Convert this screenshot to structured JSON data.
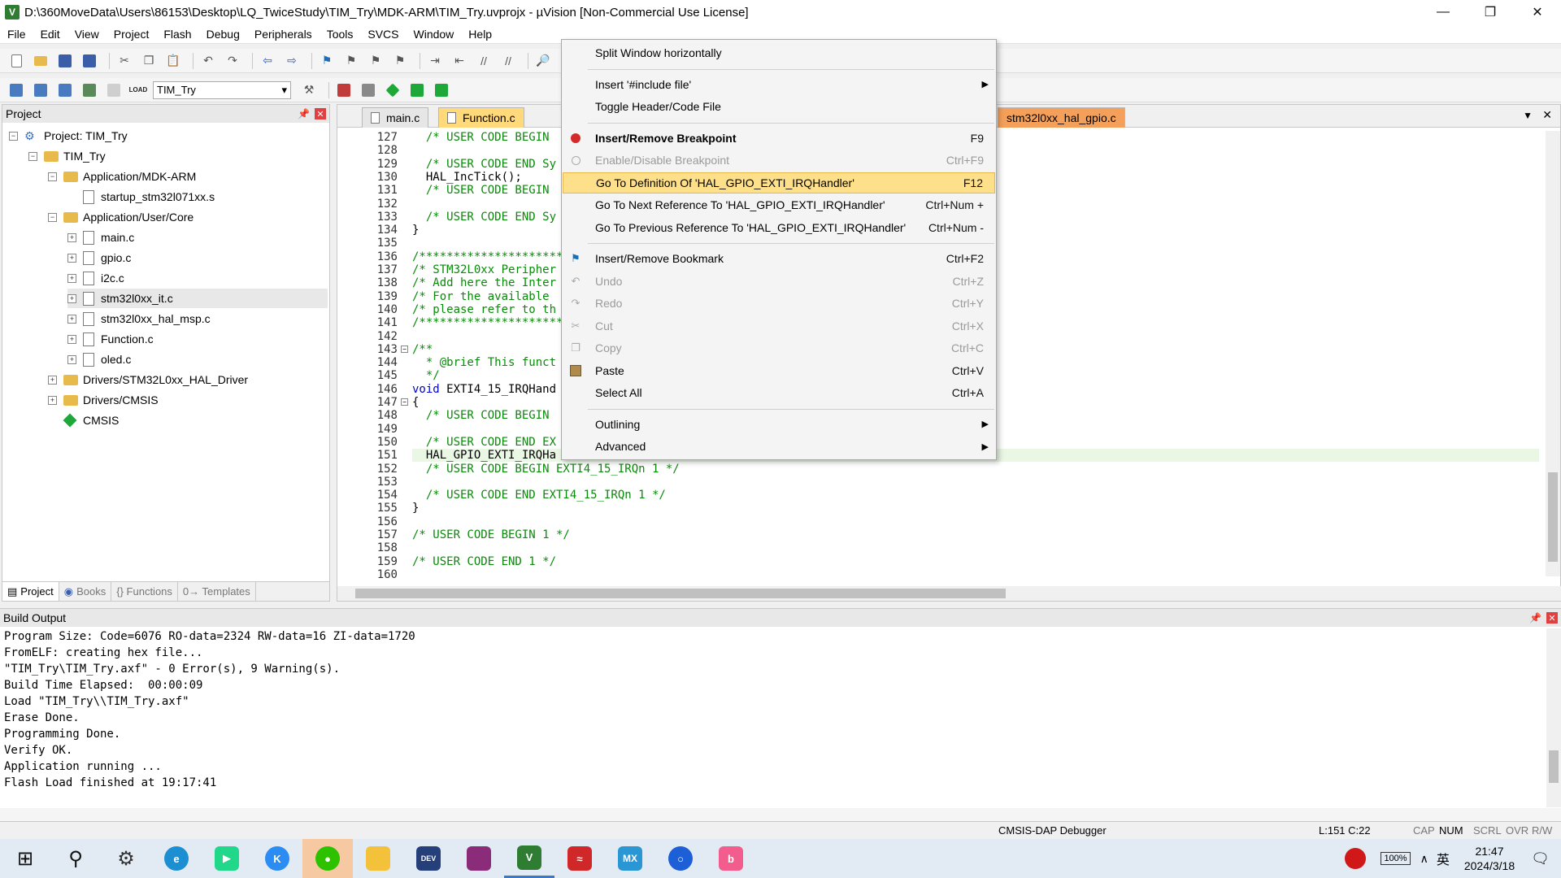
{
  "window": {
    "title": "D:\\360MoveData\\Users\\86153\\Desktop\\LQ_TwiceStudy\\TIM_Try\\MDK-ARM\\TIM_Try.uvprojx - µVision  [Non-Commercial Use License]",
    "app_icon_letter": "V"
  },
  "menubar": [
    "File",
    "Edit",
    "View",
    "Project",
    "Flash",
    "Debug",
    "Peripherals",
    "Tools",
    "SVCS",
    "Window",
    "Help"
  ],
  "toolbar2": {
    "target": "TIM_Try",
    "load_label": "LOAD"
  },
  "project_panel": {
    "title": "Project",
    "tree": [
      {
        "label": "Project: TIM_Try",
        "level": 0,
        "kind": "project",
        "exp": "−"
      },
      {
        "label": "TIM_Try",
        "level": 1,
        "kind": "target",
        "exp": "−"
      },
      {
        "label": "Application/MDK-ARM",
        "level": 2,
        "kind": "folder",
        "exp": "−"
      },
      {
        "label": "startup_stm32l071xx.s",
        "level": 3,
        "kind": "file",
        "exp": ""
      },
      {
        "label": "Application/User/Core",
        "level": 2,
        "kind": "folder",
        "exp": "−"
      },
      {
        "label": "main.c",
        "level": 3,
        "kind": "file",
        "exp": "+"
      },
      {
        "label": "gpio.c",
        "level": 3,
        "kind": "file",
        "exp": "+"
      },
      {
        "label": "i2c.c",
        "level": 3,
        "kind": "file",
        "exp": "+"
      },
      {
        "label": "stm32l0xx_it.c",
        "level": 3,
        "kind": "file",
        "exp": "+",
        "selected": true
      },
      {
        "label": "stm32l0xx_hal_msp.c",
        "level": 3,
        "kind": "file",
        "exp": "+"
      },
      {
        "label": "Function.c",
        "level": 3,
        "kind": "file",
        "exp": "+"
      },
      {
        "label": "oled.c",
        "level": 3,
        "kind": "file",
        "exp": "+"
      },
      {
        "label": "Drivers/STM32L0xx_HAL_Driver",
        "level": 2,
        "kind": "folder",
        "exp": "+"
      },
      {
        "label": "Drivers/CMSIS",
        "level": 2,
        "kind": "folder",
        "exp": "+"
      },
      {
        "label": "CMSIS",
        "level": 2,
        "kind": "cmsis",
        "exp": ""
      }
    ],
    "bottom_tabs": [
      "Project",
      "Books",
      "{} Functions",
      "0→ Templates"
    ]
  },
  "editor": {
    "tabs": [
      "main.c",
      "Function.c",
      "stm32l0xx_hal_gpio.c"
    ],
    "lines": [
      {
        "n": "127",
        "t": "  /* USER CODE BEGIN",
        "c": "cm"
      },
      {
        "n": "128",
        "t": "",
        "c": ""
      },
      {
        "n": "129",
        "t": "  /* USER CODE END Sy",
        "c": "cm"
      },
      {
        "n": "130",
        "t": "  HAL_IncTick();",
        "c": ""
      },
      {
        "n": "131",
        "t": "  /* USER CODE BEGIN",
        "c": "cm"
      },
      {
        "n": "132",
        "t": "",
        "c": ""
      },
      {
        "n": "133",
        "t": "  /* USER CODE END Sy",
        "c": "cm"
      },
      {
        "n": "134",
        "t": "}",
        "c": ""
      },
      {
        "n": "135",
        "t": "",
        "c": ""
      },
      {
        "n": "136",
        "t": "/*********************",
        "c": "cm"
      },
      {
        "n": "137",
        "t": "/* STM32L0xx Peripher",
        "c": "cm"
      },
      {
        "n": "138",
        "t": "/* Add here the Inter",
        "c": "cm"
      },
      {
        "n": "139",
        "t": "/* For the available",
        "c": "cm"
      },
      {
        "n": "140",
        "t": "/* please refer to th",
        "c": "cm"
      },
      {
        "n": "141",
        "t": "/*********************",
        "c": "cm"
      },
      {
        "n": "142",
        "t": "",
        "c": ""
      },
      {
        "n": "143",
        "t": "/**",
        "c": "cm"
      },
      {
        "n": "144",
        "t": "  * @brief This funct",
        "c": "cm"
      },
      {
        "n": "145",
        "t": "  */",
        "c": "cm"
      },
      {
        "n": "146",
        "t": "void EXTI4_15_IRQHand",
        "c": "kwline"
      },
      {
        "n": "147",
        "t": "{",
        "c": ""
      },
      {
        "n": "148",
        "t": "  /* USER CODE BEGIN",
        "c": "cm"
      },
      {
        "n": "149",
        "t": "",
        "c": ""
      },
      {
        "n": "150",
        "t": "  /* USER CODE END EX",
        "c": "cm"
      },
      {
        "n": "151",
        "t": "  HAL_GPIO_EXTI_IRQHa",
        "c": "hl"
      },
      {
        "n": "152",
        "t": "  /* USER CODE BEGIN EXTI4_15_IRQn 1 */",
        "c": "cm"
      },
      {
        "n": "153",
        "t": "",
        "c": ""
      },
      {
        "n": "154",
        "t": "  /* USER CODE END EXTI4_15_IRQn 1 */",
        "c": "cm"
      },
      {
        "n": "155",
        "t": "}",
        "c": ""
      },
      {
        "n": "156",
        "t": "",
        "c": ""
      },
      {
        "n": "157",
        "t": "/* USER CODE BEGIN 1 */",
        "c": "cm"
      },
      {
        "n": "158",
        "t": "",
        "c": ""
      },
      {
        "n": "159",
        "t": "/* USER CODE END 1 */",
        "c": "cm"
      },
      {
        "n": "160",
        "t": "",
        "c": ""
      }
    ]
  },
  "context_menu": {
    "items": [
      {
        "label": "Split Window horizontally",
        "shortcut": "",
        "disabled": false,
        "icon": ""
      },
      {
        "sep": true
      },
      {
        "label": "Insert '#include file'",
        "shortcut": "",
        "submenu": true
      },
      {
        "label": "Toggle Header/Code File",
        "shortcut": ""
      },
      {
        "sep": true
      },
      {
        "label": "Insert/Remove Breakpoint",
        "shortcut": "F9",
        "bold": true,
        "icon": "breakpoint-icon"
      },
      {
        "label": "Enable/Disable Breakpoint",
        "shortcut": "Ctrl+F9",
        "disabled": true,
        "icon": "breakpoint-disabled-icon"
      },
      {
        "label": "Go To Definition Of 'HAL_GPIO_EXTI_IRQHandler'",
        "shortcut": "F12",
        "selected": true
      },
      {
        "label": "Go To Next Reference To 'HAL_GPIO_EXTI_IRQHandler'",
        "shortcut": "Ctrl+Num +"
      },
      {
        "label": "Go To Previous Reference To 'HAL_GPIO_EXTI_IRQHandler'",
        "shortcut": "Ctrl+Num -"
      },
      {
        "sep": true
      },
      {
        "label": "Insert/Remove Bookmark",
        "shortcut": "Ctrl+F2",
        "icon": "bookmark-icon"
      },
      {
        "label": "Undo",
        "shortcut": "Ctrl+Z",
        "disabled": true,
        "icon": "undo-icon"
      },
      {
        "label": "Redo",
        "shortcut": "Ctrl+Y",
        "disabled": true,
        "icon": "redo-icon"
      },
      {
        "label": "Cut",
        "shortcut": "Ctrl+X",
        "disabled": true,
        "icon": "cut-icon"
      },
      {
        "label": "Copy",
        "shortcut": "Ctrl+C",
        "disabled": true,
        "icon": "copy-icon"
      },
      {
        "label": "Paste",
        "shortcut": "Ctrl+V",
        "icon": "paste-icon"
      },
      {
        "label": "Select All",
        "shortcut": "Ctrl+A"
      },
      {
        "sep": true
      },
      {
        "label": "Outlining",
        "shortcut": "",
        "submenu": true
      },
      {
        "label": "Advanced",
        "shortcut": "",
        "submenu": true
      }
    ]
  },
  "build_output": {
    "title": "Build Output",
    "lines": [
      "Program Size: Code=6076 RO-data=2324 RW-data=16 ZI-data=1720",
      "FromELF: creating hex file...",
      "\"TIM_Try\\TIM_Try.axf\" - 0 Error(s), 9 Warning(s).",
      "Build Time Elapsed:  00:00:09",
      "Load \"TIM_Try\\\\TIM_Try.axf\"",
      "Erase Done.",
      "Programming Done.",
      "Verify OK.",
      "Application running ...",
      "Flash Load finished at 19:17:41"
    ]
  },
  "statusbar": {
    "debugger": "CMSIS-DAP Debugger",
    "position": "L:151 C:22",
    "cap": "CAP",
    "num": "NUM",
    "scrl": "SCRL",
    "ovr": "OVR",
    "rw": "R/W"
  },
  "taskbar": {
    "apps": [
      "windows-start",
      "search",
      "settings",
      "edge",
      "pycharm",
      "kugou",
      "wechat",
      "file-explorer",
      "devcpp",
      "winrar",
      "keil",
      "multisim",
      "stm32cubemx",
      "browser",
      "bilibili"
    ],
    "battery": "100%",
    "ime": "英",
    "time": "21:47",
    "date": "2024/3/18"
  },
  "colors": {
    "menu_highlight": "#ffe08a",
    "active_tab": "#ffd97a",
    "hal_tab": "#f4a05a",
    "comment": "#0a8a0a",
    "keyword": "#0000cc"
  }
}
